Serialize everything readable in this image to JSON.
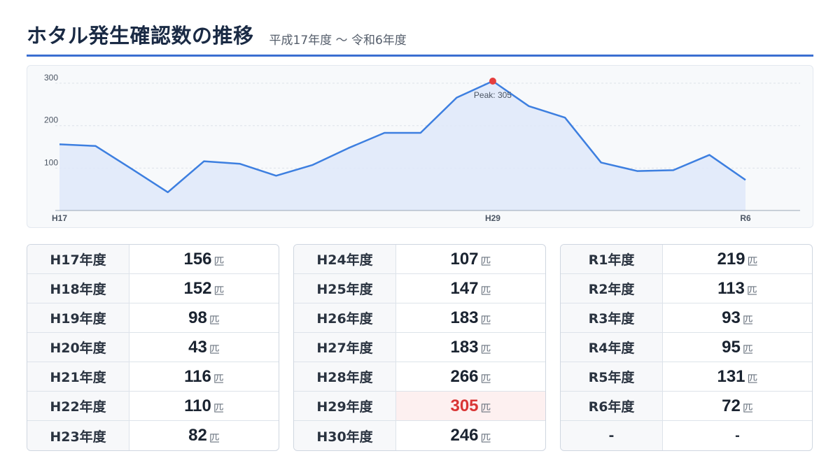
{
  "header": {
    "title": "ホタル発生確認数の推移",
    "subtitle": "平成17年度 〜 令和6年度"
  },
  "colors": {
    "accent": "#3b6fd1",
    "line": "#3d7fe0",
    "area": "#dfe9f9",
    "peak": "#e53e3e"
  },
  "chart_data": {
    "type": "area",
    "title": "ホタル発生確認数の推移",
    "categories": [
      "H17",
      "H18",
      "H19",
      "H20",
      "H21",
      "H22",
      "H23",
      "H24",
      "H25",
      "H26",
      "H27",
      "H28",
      "H29",
      "H30",
      "R1",
      "R2",
      "R3",
      "R4",
      "R5",
      "R6"
    ],
    "values": [
      156,
      152,
      98,
      43,
      116,
      110,
      82,
      107,
      147,
      183,
      183,
      266,
      305,
      246,
      219,
      113,
      93,
      95,
      131,
      72
    ],
    "ylim": [
      0,
      305
    ],
    "yticks": [
      100,
      200,
      300
    ],
    "xticks_shown": [
      "H17",
      "H29",
      "R6"
    ],
    "grid": true,
    "peak_label": "Peak: 305"
  },
  "tables": [
    {
      "rows": [
        {
          "label": "H17年度",
          "value": "156",
          "unit": "匹"
        },
        {
          "label": "H18年度",
          "value": "152",
          "unit": "匹"
        },
        {
          "label": "H19年度",
          "value": "98",
          "unit": "匹"
        },
        {
          "label": "H20年度",
          "value": "43",
          "unit": "匹"
        },
        {
          "label": "H21年度",
          "value": "116",
          "unit": "匹"
        },
        {
          "label": "H22年度",
          "value": "110",
          "unit": "匹"
        },
        {
          "label": "H23年度",
          "value": "82",
          "unit": "匹"
        }
      ]
    },
    {
      "rows": [
        {
          "label": "H24年度",
          "value": "107",
          "unit": "匹"
        },
        {
          "label": "H25年度",
          "value": "147",
          "unit": "匹"
        },
        {
          "label": "H26年度",
          "value": "183",
          "unit": "匹"
        },
        {
          "label": "H27年度",
          "value": "183",
          "unit": "匹"
        },
        {
          "label": "H28年度",
          "value": "266",
          "unit": "匹"
        },
        {
          "label": "H29年度",
          "value": "305",
          "unit": "匹",
          "highlight": true
        },
        {
          "label": "H30年度",
          "value": "246",
          "unit": "匹"
        }
      ]
    },
    {
      "rows": [
        {
          "label": "R1年度",
          "value": "219",
          "unit": "匹"
        },
        {
          "label": "R2年度",
          "value": "113",
          "unit": "匹"
        },
        {
          "label": "R3年度",
          "value": "93",
          "unit": "匹"
        },
        {
          "label": "R4年度",
          "value": "95",
          "unit": "匹"
        },
        {
          "label": "R5年度",
          "value": "131",
          "unit": "匹"
        },
        {
          "label": "R6年度",
          "value": "72",
          "unit": "匹"
        },
        {
          "label": "-",
          "value": "-",
          "unit": ""
        }
      ]
    }
  ]
}
